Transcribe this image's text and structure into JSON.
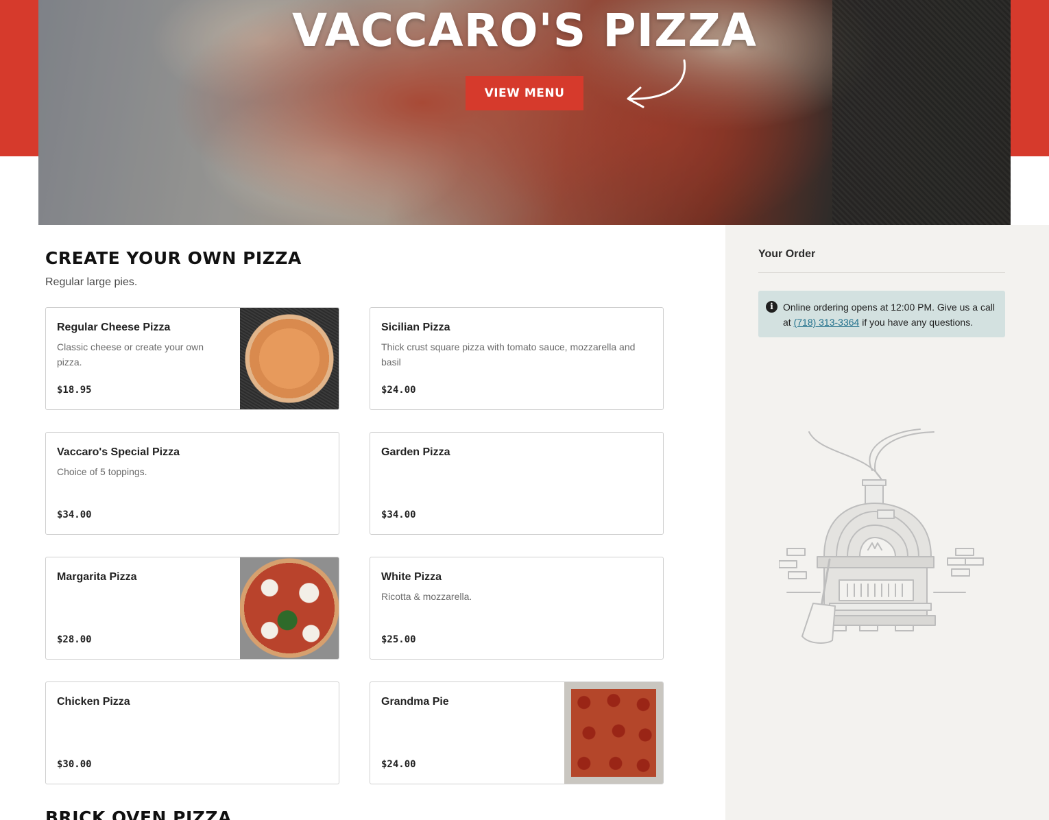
{
  "hero": {
    "title": "VACCARO'S PIZZA",
    "button_label": "VIEW MENU"
  },
  "sections": [
    {
      "title": "CREATE YOUR OWN PIZZA",
      "subtitle": "Regular large pies.",
      "items": [
        {
          "name": "Regular Cheese Pizza",
          "description": "Classic cheese or create your own pizza.",
          "price": "$18.95"
        },
        {
          "name": "Sicilian Pizza",
          "description": "Thick crust square pizza with tomato sauce, mozzarella and basil",
          "price": "$24.00"
        },
        {
          "name": "Vaccaro's Special Pizza",
          "description": "Choice of 5 toppings.",
          "price": "$34.00"
        },
        {
          "name": "Garden Pizza",
          "description": "",
          "price": "$34.00"
        },
        {
          "name": "Margarita Pizza",
          "description": "",
          "price": "$28.00"
        },
        {
          "name": "White Pizza",
          "description": "Ricotta & mozzarella.",
          "price": "$25.00"
        },
        {
          "name": "Chicken Pizza",
          "description": "",
          "price": "$30.00"
        },
        {
          "name": "Grandma Pie",
          "description": "",
          "price": "$24.00"
        }
      ]
    },
    {
      "title": "BRICK OVEN PIZZA"
    }
  ],
  "order": {
    "title": "Your Order",
    "notice_prefix": "Online ordering opens at 12:00 PM. Give us a call at ",
    "phone": "(718) 313-3364",
    "notice_suffix": " if you have any questions.",
    "info_icon": "i"
  },
  "colors": {
    "brand_red": "#d63a2c",
    "notice_bg": "#d3e1e0",
    "link": "#1f6f8b",
    "sidebar_bg": "#f3f2ef"
  }
}
